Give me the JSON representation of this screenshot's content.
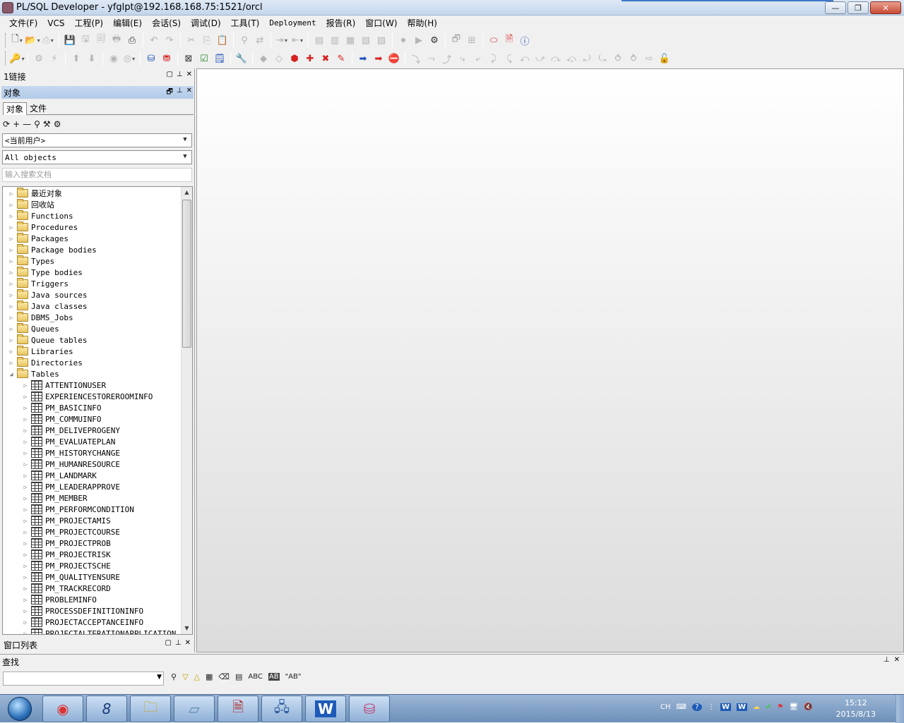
{
  "window": {
    "title": "PL/SQL Developer - yfglpt@192.168.168.75:1521/orcl"
  },
  "window_controls": {
    "minimize": "—",
    "restore": "❐",
    "close": "✕"
  },
  "menu": [
    "文件(F)",
    "VCS",
    "工程(P)",
    "编辑(E)",
    "会话(S)",
    "调试(D)",
    "工具(T)",
    "Deployment",
    "报告(R)",
    "窗口(W)",
    "帮助(H)"
  ],
  "panes": {
    "connections_title": "1链接",
    "objects_title": "对象",
    "window_list_title": "窗口列表",
    "find_title": "查找"
  },
  "object_tabs": [
    "对象",
    "文件"
  ],
  "object_toolbar": [
    "⟳",
    "+",
    "—",
    "⚲",
    "⚒",
    "⚙"
  ],
  "user_combo": {
    "value": "<当前用户>"
  },
  "filter_combo": {
    "value": "All objects"
  },
  "search": {
    "placeholder": "输入搜索文档"
  },
  "tree": {
    "folders": [
      "最近对象",
      "回收站",
      "Functions",
      "Procedures",
      "Packages",
      "Package bodies",
      "Types",
      "Type bodies",
      "Triggers",
      "Java sources",
      "Java classes",
      "DBMS_Jobs",
      "Queues",
      "Queue tables",
      "Libraries",
      "Directories"
    ],
    "tables_folder": "Tables",
    "tables": [
      "ATTENTIONUSER",
      "EXPERIENCESTOREROOMINFO",
      "PM_BASICINFO",
      "PM_COMMUINFO",
      "PM_DELIVEPROGENY",
      "PM_EVALUATEPLAN",
      "PM_HISTORYCHANGE",
      "PM_HUMANRESOURCE",
      "PM_LANDMARK",
      "PM_LEADERAPPROVE",
      "PM_MEMBER",
      "PM_PERFORMCONDITION",
      "PM_PROJECTAMIS",
      "PM_PROJECTCOURSE",
      "PM_PROJECTPROB",
      "PM_PROJECTRISK",
      "PM_PROJECTSCHE",
      "PM_QUALITYENSURE",
      "PM_TRACKRECORD",
      "PROBLEMINFO",
      "PROCESSDEFINITIONINFO",
      "PROJECTACCEPTANCEINFO",
      "PROJECTALTERATIONAPPLICATION"
    ]
  },
  "find_tools": [
    "ABC",
    "AB",
    "\"AB\""
  ],
  "taskbar": {
    "apps": [
      "chrome-icon",
      "plsql-icon",
      "explorer-icon",
      "notepad-icon",
      "editor-icon",
      "network-icon",
      "word-icon",
      "database-icon"
    ],
    "tray_lang": "CH",
    "time": "15:12",
    "date": "2015/8/13"
  }
}
